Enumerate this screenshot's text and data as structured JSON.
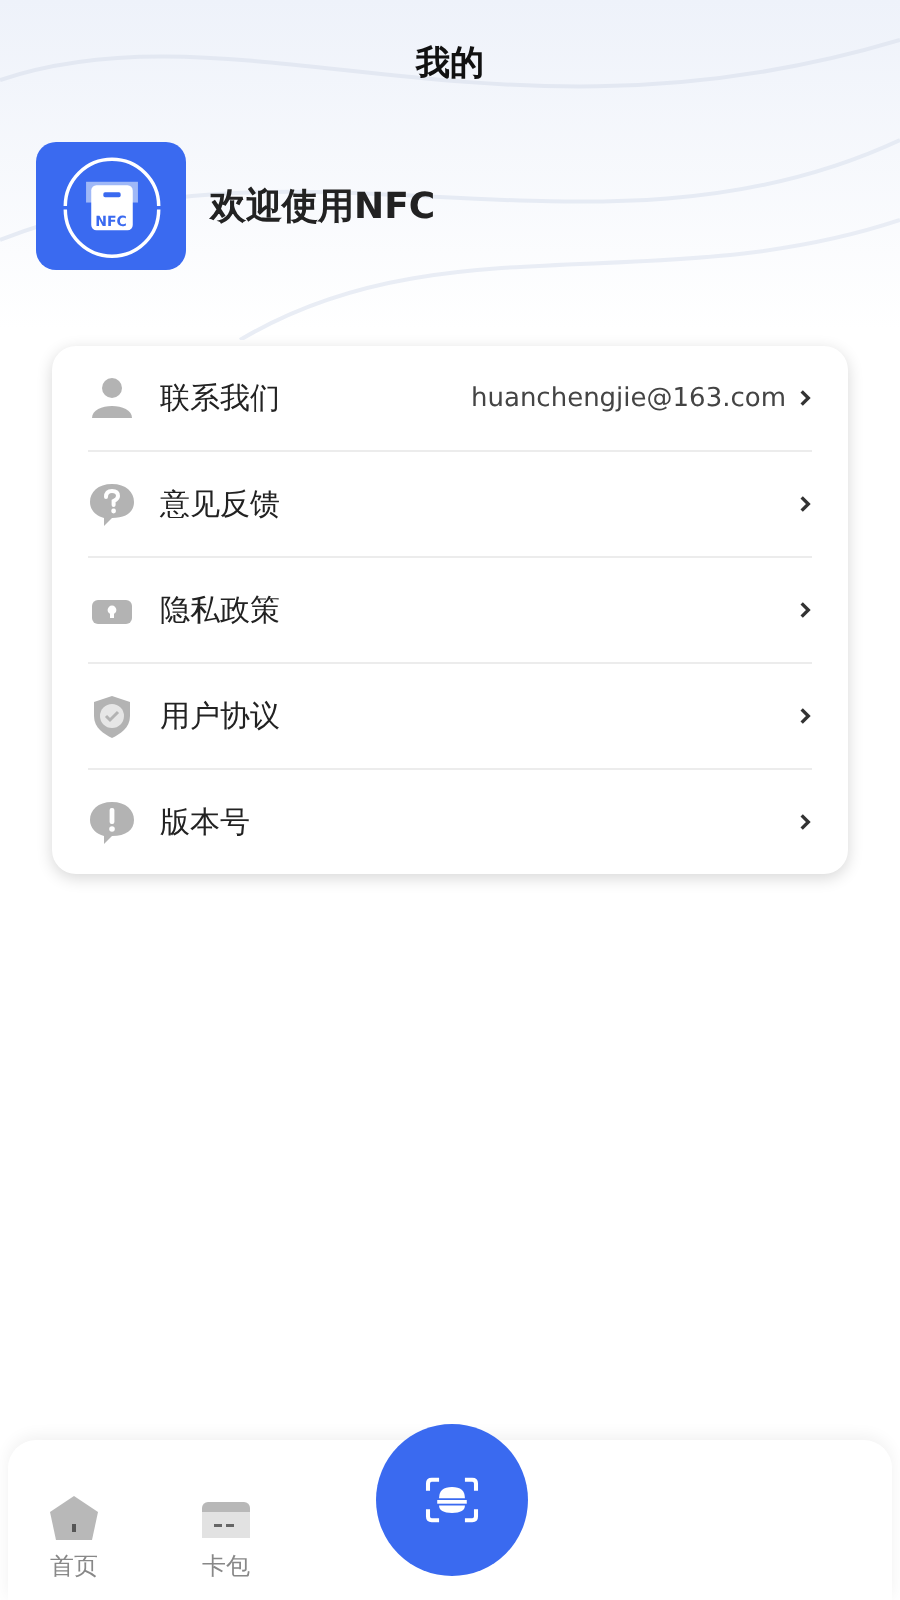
{
  "header": {
    "title": "我的"
  },
  "profile": {
    "welcome": "欢迎使用NFC",
    "logo_text": "NFC"
  },
  "menu": [
    {
      "label": "联系我们",
      "value": "huanchengjie@163.com"
    },
    {
      "label": "意见反馈"
    },
    {
      "label": "隐私政策"
    },
    {
      "label": "用户协议"
    },
    {
      "label": "版本号"
    }
  ],
  "tab_bar": {
    "tabs": [
      {
        "label": "首页",
        "selected": false
      },
      {
        "label": "卡包",
        "selected": false
      }
    ]
  }
}
